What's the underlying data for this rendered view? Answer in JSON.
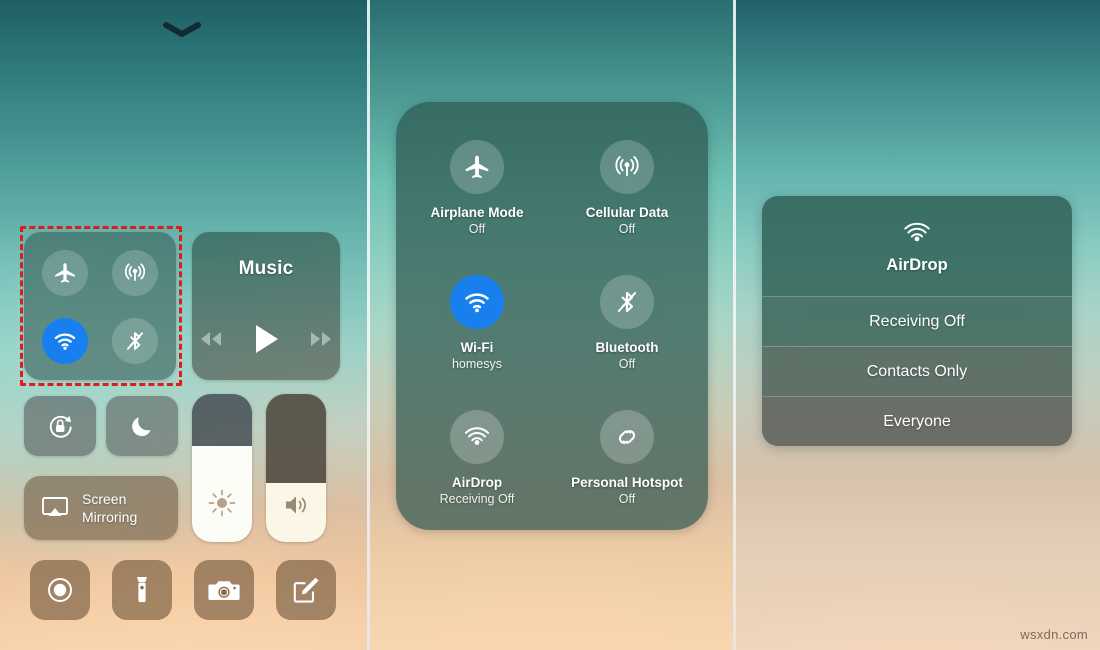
{
  "watermark": "wsxdn.com",
  "colors": {
    "accent_blue": "#1880EE",
    "highlight_red": "#e01b1b",
    "panel_tint": "rgba(44,86,78,0.70)"
  },
  "panel_left": {
    "chevron_icon": "chevron-down-icon",
    "connectivity": {
      "highlighted": true,
      "toggles": [
        {
          "icon": "airplane-icon",
          "name": "airplane-mode",
          "state": "off"
        },
        {
          "icon": "cellular-icon",
          "name": "cellular-data",
          "state": "off"
        },
        {
          "icon": "wifi-icon",
          "name": "wifi",
          "state": "on"
        },
        {
          "icon": "bluetooth-off-icon",
          "name": "bluetooth",
          "state": "off"
        }
      ]
    },
    "music": {
      "title": "Music",
      "controls": [
        {
          "icon": "rewind-icon",
          "name": "previous-track"
        },
        {
          "icon": "play-icon",
          "name": "play"
        },
        {
          "icon": "forward-icon",
          "name": "next-track"
        }
      ]
    },
    "tiles": [
      {
        "name": "rotation-lock",
        "icon": "rotation-lock-icon"
      },
      {
        "name": "do-not-disturb",
        "icon": "moon-icon"
      }
    ],
    "screen_mirroring": {
      "label_line1": "Screen",
      "label_line2": "Mirroring",
      "icon": "airplay-icon"
    },
    "sliders": [
      {
        "name": "brightness-slider",
        "icon": "brightness-icon",
        "value": 65
      },
      {
        "name": "volume-slider",
        "icon": "volume-icon",
        "value": 40
      }
    ],
    "shortcuts": [
      {
        "name": "screen-record",
        "icon": "record-icon"
      },
      {
        "name": "flashlight",
        "icon": "flashlight-icon"
      },
      {
        "name": "camera",
        "icon": "camera-icon"
      },
      {
        "name": "notes",
        "icon": "notes-icon"
      }
    ]
  },
  "panel_mid": {
    "connectivity_card": {
      "items": [
        {
          "icon": "airplane-icon",
          "title": "Airplane Mode",
          "subtitle": "Off",
          "state": "off"
        },
        {
          "icon": "cellular-icon",
          "title": "Cellular Data",
          "subtitle": "Off",
          "state": "off"
        },
        {
          "icon": "wifi-icon",
          "title": "Wi-Fi",
          "subtitle": "homesys",
          "state": "on"
        },
        {
          "icon": "bluetooth-off-icon",
          "title": "Bluetooth",
          "subtitle": "Off",
          "state": "off"
        },
        {
          "icon": "airdrop-icon",
          "title": "AirDrop",
          "subtitle": "Receiving Off",
          "state": "off",
          "highlighted": true
        },
        {
          "icon": "hotspot-icon",
          "title": "Personal Hotspot",
          "subtitle": "Off",
          "state": "off"
        }
      ]
    }
  },
  "panel_right": {
    "airdrop_menu": {
      "header_icon": "airdrop-icon",
      "header_label": "AirDrop",
      "options": [
        {
          "label": "Receiving Off"
        },
        {
          "label": "Contacts Only"
        },
        {
          "label": "Everyone"
        }
      ]
    }
  }
}
